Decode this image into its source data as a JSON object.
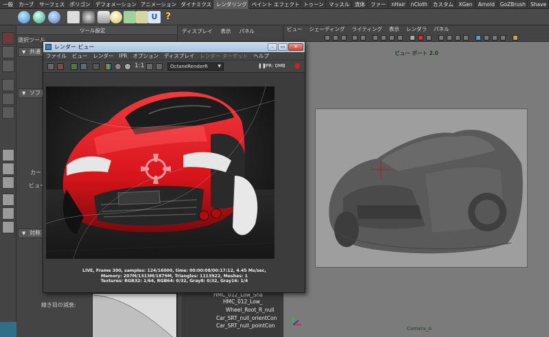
{
  "shelf": {
    "tabs": [
      "一般",
      "カーブ",
      "サーフェス",
      "ポリゴン",
      "デフォメーション",
      "アニメーション",
      "ダイナミクス",
      "レンダリング",
      "ペイント エフェクト",
      "トゥーン",
      "マッスル",
      "流体",
      "ファー",
      "nHair",
      "nCloth",
      "カスタム",
      "XGen",
      "Arnold",
      "GoZBrush",
      "Shave"
    ]
  },
  "tool_settings": {
    "header_label": "ツール設定",
    "title": "選択ツール",
    "sections": [
      "共通",
      "ソフト",
      "対称"
    ],
    "labels": [
      "カー",
      "ビュー"
    ],
    "curve_label": "線き目の減衰:"
  },
  "outliner": {
    "menu": [
      "ディスプレイ",
      "表示",
      "パネル"
    ],
    "tree_items": [
      "HMC_012_Low_Sha",
      "HMC_012_Low_",
      "Wheel_Root_R_null",
      "Car_SRT_null_orientCon",
      "Car_SRT_null_pointCon"
    ]
  },
  "viewport": {
    "menu": [
      "ビュー",
      "シェーディング",
      "ライティング",
      "表示",
      "レンダラ",
      "パネル"
    ],
    "title": "ビュー ポート 2.0",
    "camera_label": "Camera_A"
  },
  "render_view": {
    "title": "レンダー ビュー",
    "menu": [
      "ファイル",
      "ビュー",
      "レンダー",
      "IPR",
      "オプション",
      "ディスプレイ",
      "レンダー ターゲット",
      "ヘルプ"
    ],
    "menu_disabled": [
      false,
      false,
      false,
      false,
      false,
      false,
      true,
      false
    ],
    "one_to_one": "1:1",
    "renderer": "OctaneRenderR",
    "ipr_status": "IPR: 0MB",
    "stats": [
      "LIVE, Frame 300, samples: 124/16000, time: 00:00:08/00:17:12, 4.45 Ms/sec,",
      "Memory: 207M/1313M/1879M, Triangles: 1113922, Meshes: 1",
      "Textures: RGB32: 1/64, RGB64: 0/32, Gray8: 0/32, Gray16: 1/4"
    ]
  },
  "colors": {
    "car_red": "#d8141b",
    "maya_bg": "#444444",
    "viewport_bg": "#7b7b7b"
  }
}
